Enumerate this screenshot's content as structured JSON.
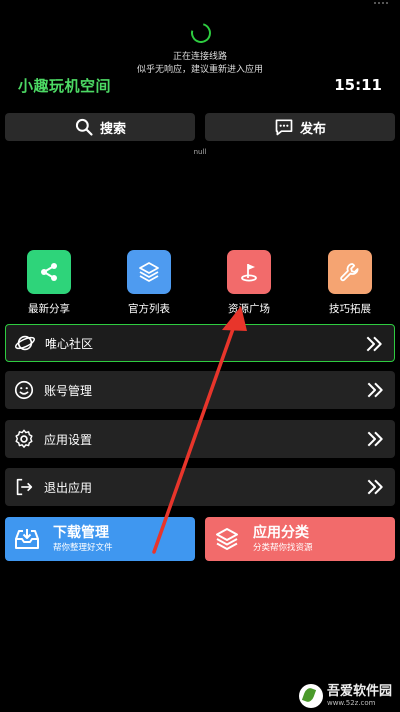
{
  "status": {
    "connecting": "正在连接线路",
    "hint": "似乎无响应，建议重新进入应用"
  },
  "header": {
    "title": "小趣玩机空间",
    "time": "15:11"
  },
  "top_buttons": {
    "search": "搜索",
    "publish": "发布"
  },
  "null_text": "null",
  "grid": [
    {
      "label": "最新分享",
      "icon": "share-icon",
      "color": "#2ed47a"
    },
    {
      "label": "官方列表",
      "icon": "layers-icon",
      "color": "#4e9bf0"
    },
    {
      "label": "资源广场",
      "icon": "flag-icon",
      "color": "#f26b6b"
    },
    {
      "label": "技巧拓展",
      "icon": "wrench-icon",
      "color": "#f5a472"
    }
  ],
  "menu": [
    {
      "label": "唯心社区",
      "icon": "planet-icon"
    },
    {
      "label": "账号管理",
      "icon": "smile-icon"
    },
    {
      "label": "应用设置",
      "icon": "gear-icon"
    },
    {
      "label": "退出应用",
      "icon": "exit-icon"
    }
  ],
  "big_buttons": [
    {
      "title": "下载管理",
      "subtitle": "帮你整理好文件",
      "color": "#3f97f0"
    },
    {
      "title": "应用分类",
      "subtitle": "分类帮你找资源",
      "color": "#f26b6b"
    }
  ],
  "watermark": {
    "title": "吾爱软件园",
    "url": "www.52z.com"
  },
  "colors": {
    "accent": "#2ecc40",
    "background": "#000000",
    "row": "#232323"
  }
}
